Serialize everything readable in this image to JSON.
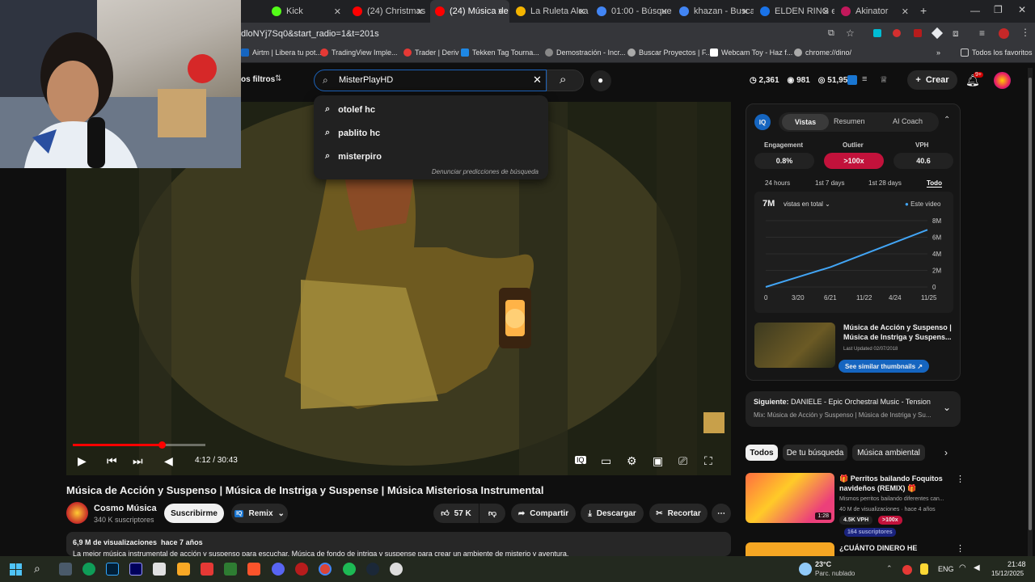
{
  "browser": {
    "tabs": [
      {
        "label": "Kick",
        "color": "#53fc18"
      },
      {
        "label": "(24) Christmas",
        "color": "#ff0000"
      },
      {
        "label": "(24) Música de",
        "color": "#ff0000"
      },
      {
        "label": "La Ruleta Alea",
        "color": "#f4b400"
      },
      {
        "label": "01:00 - Búsque",
        "color": "#4285f4"
      },
      {
        "label": "khazan - Busca",
        "color": "#4285f4"
      },
      {
        "label": "ELDEN RING e",
        "color": "#1a73e8"
      },
      {
        "label": "Akinator",
        "color": "#c2185b"
      }
    ],
    "url": "dloNYj7Sq0&start_radio=1&t=201s",
    "bookmarks": [
      "Airtm | Libera tu pot...",
      "TradingView Imple...",
      "Trader | Deriv",
      "Tekken Tag Tourna...",
      "Demostración - Incr...",
      "Buscar Proyectos | F...",
      "Webcam Toy - Haz f...",
      "chrome://dino/"
    ],
    "bookmarks_right": "Todos los favoritos"
  },
  "yt": {
    "filters_label": "os filtros",
    "search_value": "MisterPlayHD",
    "suggestions": [
      "otolef hc",
      "pablito hc",
      "misterpiro"
    ],
    "suggest_footer": "Denunciar predicciones de búsqueda",
    "stats": {
      "a": "2,361",
      "b": "981",
      "c": "51,958"
    },
    "create_label": "Crear",
    "notif_badge": "9+"
  },
  "video": {
    "time": "4:12 / 30:43",
    "progress": 0.137,
    "title": "Música de Acción y Suspenso | Música de Instriga y Suspense | Música Misteriosa Instrumental",
    "channel": "Cosmo Música",
    "subs": "340 K suscriptores",
    "subscribe": "Suscribirme",
    "remix": "Remix",
    "likes": "57 K",
    "share": "Compartir",
    "download": "Descargar",
    "clip": "Recortar",
    "views_line": "6,9 M de visualizaciones  hace 7 años",
    "desc_line": "La mejor música instrumental de acción y suspenso para escuchar. Música de fondo de intriga y suspense para crear un ambiente de misterio y aventura."
  },
  "iq": {
    "tabs": [
      "Vistas",
      "Resumen",
      "AI Coach"
    ],
    "metrics": [
      {
        "label": "Engagement",
        "value": "0.8%"
      },
      {
        "label": "Outlier",
        "value": ">100x"
      },
      {
        "label": "VPH",
        "value": "40.6"
      }
    ],
    "ranges": [
      "24 hours",
      "1st 7 days",
      "1st 28 days",
      "Todo"
    ],
    "total": "7M",
    "total_label": "vistas en total",
    "legend": "Este video",
    "thumb_title": "Música de Acción y Suspenso | Música de Instriga y Suspens...",
    "updated": "Last Updated 02/07/2018",
    "similar_btn": "See similar thumbnails"
  },
  "chart_data": {
    "type": "line",
    "x": [
      "0",
      "3/20",
      "6/21",
      "11/22",
      "4/24",
      "11/25"
    ],
    "series": [
      {
        "name": "Este video",
        "values": [
          0,
          1.2,
          2.4,
          3.9,
          5.4,
          6.9
        ]
      }
    ],
    "yticks": [
      "0",
      "2M",
      "4M",
      "6M",
      "8M"
    ],
    "ylim": [
      0,
      8
    ]
  },
  "next": {
    "label": "Siguiente:",
    "title": "DANIELE - Epic Orchestral Music - Tension",
    "sub": "Mix: Música de Acción y Suspenso | Música de Instriga y Su..."
  },
  "chips": [
    "Todos",
    "De tu búsqueda",
    "Música ambiental"
  ],
  "related": [
    {
      "title": "🎁 Perritos bailando Foquitos navideños (REMIX) 🎁",
      "desc": "Mismos perritos bailando diferentes can...",
      "meta": "40 M de visualizaciones · hace 4 años",
      "vph": "4.5K VPH",
      "badge": ">100x",
      "subs": "164 suscriptores",
      "duration": "1:28"
    },
    {
      "title": "¿CUÁNTO DINERO HE GANADO CON ROBLOX?"
    }
  ],
  "taskbar": {
    "temp": "23°C",
    "weather": "Parc. nublado",
    "lang": "ENG",
    "time": "21:48",
    "date": "15/12/2025"
  }
}
